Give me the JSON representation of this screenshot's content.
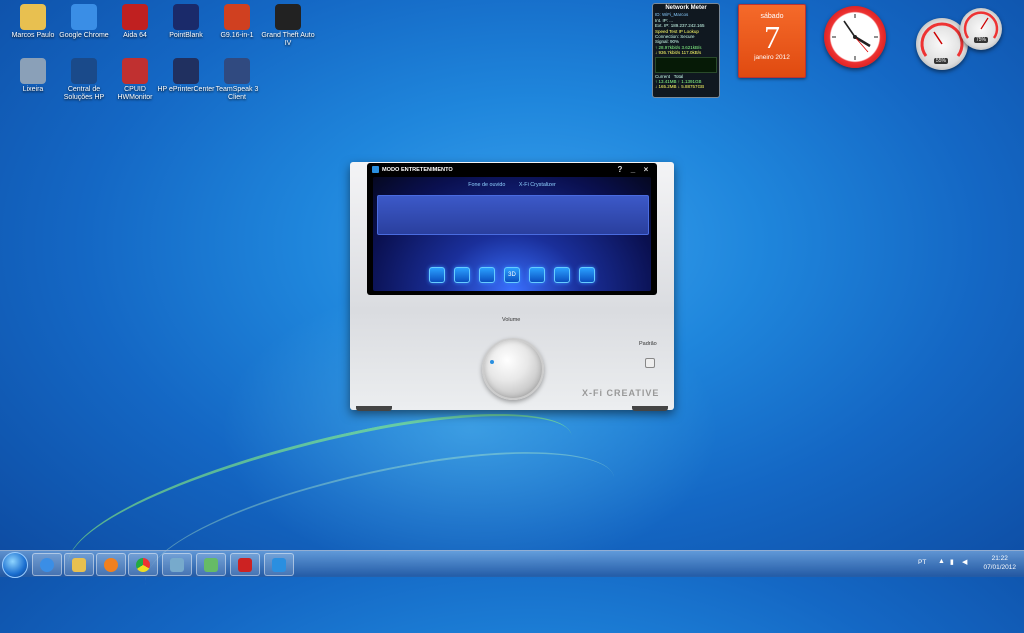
{
  "desktop_icons": [
    {
      "label": "Marcos Paulo",
      "icon": "folder-icon",
      "color": "#e8c050"
    },
    {
      "label": "Google Chrome",
      "icon": "chrome-icon",
      "color": "#3a8ee6"
    },
    {
      "label": "Aida 64",
      "icon": "aida64-icon",
      "color": "#c02020"
    },
    {
      "label": "PointBlank",
      "icon": "pointblank-icon",
      "color": "#1a2a6a"
    },
    {
      "label": "G9.16-in-1",
      "icon": "g9-icon",
      "color": "#d04020"
    },
    {
      "label": "Grand Theft Auto IV",
      "icon": "gta4-icon",
      "color": "#222222"
    },
    {
      "label": "Lixeira",
      "icon": "recycle-bin-icon",
      "color": "#8aa0b8"
    },
    {
      "label": "Central de Soluções HP",
      "icon": "hp-icon",
      "color": "#1a4a8a"
    },
    {
      "label": "CPUID HWMonitor",
      "icon": "hwmonitor-icon",
      "color": "#c03030"
    },
    {
      "label": "HP ePrinterCenter",
      "icon": "printer-icon",
      "color": "#203060"
    },
    {
      "label": "TeamSpeak 3 Client",
      "icon": "teamspeak-icon",
      "color": "#304a80"
    }
  ],
  "network_meter": {
    "title": "Network Meter",
    "lines": [
      "ID: WiFi_Marcos",
      "Int. IP: ...",
      "Ext. IP: 189.237.242.165",
      "Speed Test    IP Lookup",
      "Connection: Secure",
      "Signal: 90%",
      "↑ 28.97kbit/s   3.621kB/s",
      "↓ 936.7kbit/s   117.0kB/s"
    ],
    "current_label": "Current",
    "total_label": "Total",
    "up_current": "13.41MB",
    "up_total": "1.1391GB",
    "down_current": "165.2MB",
    "down_total": "5.88757GB"
  },
  "calendar": {
    "day_name": "sábado",
    "day": "7",
    "month_year": "janeiro 2012"
  },
  "gauges": {
    "cpu": "55%",
    "ram": "75%"
  },
  "window": {
    "title": "MODO ENTRETENIMENTO",
    "help": "?",
    "minimize": "_",
    "close": "×",
    "tabs": [
      "Fone de ouvido",
      "X-Fi Crystalizer"
    ],
    "feature_buttons": [
      "speaker-icon",
      "headphone-icon",
      "eq-icon",
      "3d-icon",
      "crystalizer-icon",
      "grid-icon",
      "mixer-icon"
    ],
    "feature_labels": [
      "",
      "",
      "",
      "3D",
      "",
      "",
      ""
    ],
    "volume_label": "Volume",
    "padrao_label": "Padrão",
    "brand": "X-Fi CREATIVE"
  },
  "taskbar": {
    "apps": [
      "ie-icon",
      "explorer-icon",
      "media-player-icon",
      "chrome-icon",
      "network-icon",
      "users-icon",
      "game-icon",
      "creative-icon"
    ],
    "language": "PT",
    "time": "21:22",
    "date": "07/01/2012"
  }
}
